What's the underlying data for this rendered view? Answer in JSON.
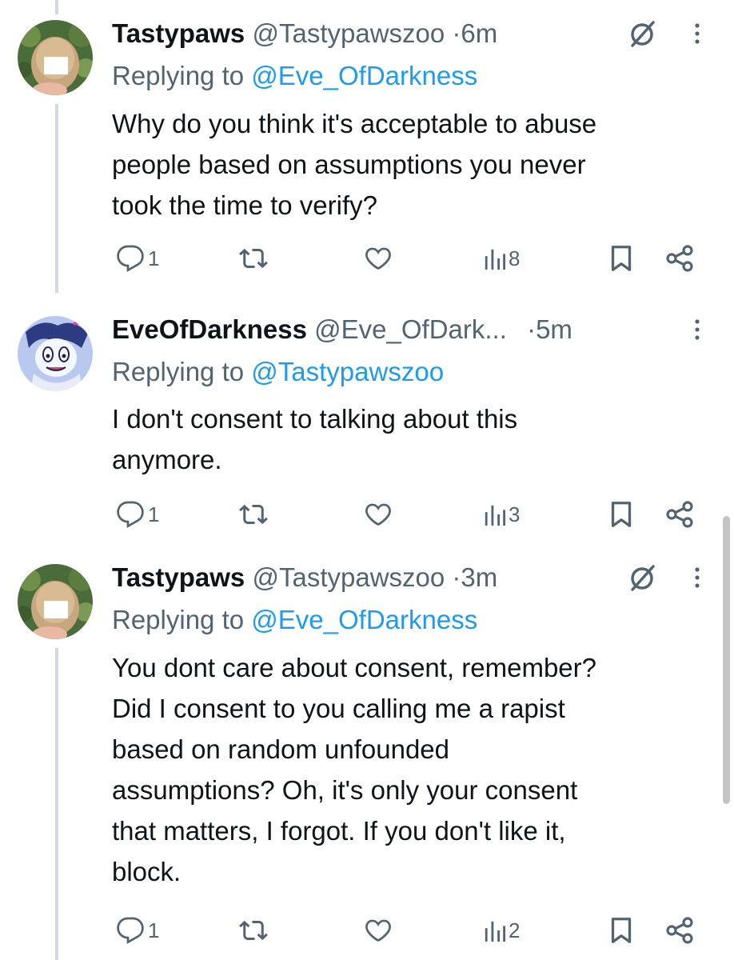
{
  "tweets": [
    {
      "display_name": "Tastypaws",
      "handle": "@Tastypawszoo",
      "dot": "·",
      "time": "6m",
      "reply_prefix": "Replying to",
      "reply_to": "@Eve_OfDarkness",
      "body": [
        "Why do you think it's acceptable to abuse",
        "people based on assumptions you never",
        "took the time to verify?"
      ],
      "stats": {
        "replies": "1",
        "reposts": "",
        "likes": "",
        "views": "8"
      },
      "avatar": "crochet-avatar-icon",
      "grok_icon": "grok-slash-icon"
    },
    {
      "display_name": "EveOfDarkness",
      "handle": "@Eve_OfDark...",
      "dot": "·",
      "time": "5m",
      "reply_prefix": "Replying to",
      "reply_to": "@Tastypawszoo",
      "body": [
        "I don't consent to talking about this",
        "anymore."
      ],
      "stats": {
        "replies": "1",
        "reposts": "",
        "likes": "",
        "views": "3"
      },
      "avatar": "cartoon-avatar-icon"
    },
    {
      "display_name": "Tastypaws",
      "handle": "@Tastypawszoo",
      "dot": "·",
      "time": "3m",
      "reply_prefix": "Replying to",
      "reply_to": "@Eve_OfDarkness",
      "body": [
        "You dont care about consent, remember?",
        "Did I consent to you calling me a rapist",
        "based on random unfounded",
        "assumptions? Oh, it's only your consent",
        "that matters, I forgot. If you don't like it,",
        "block."
      ],
      "stats": {
        "replies": "1",
        "reposts": "",
        "likes": "",
        "views": "2"
      },
      "avatar": "crochet-avatar-icon",
      "grok_icon": "grok-slash-icon"
    }
  ],
  "colors": {
    "text": "#0f1419",
    "secondary": "#536471",
    "link": "#1d9bf0",
    "thread_line": "#cfd9de"
  }
}
